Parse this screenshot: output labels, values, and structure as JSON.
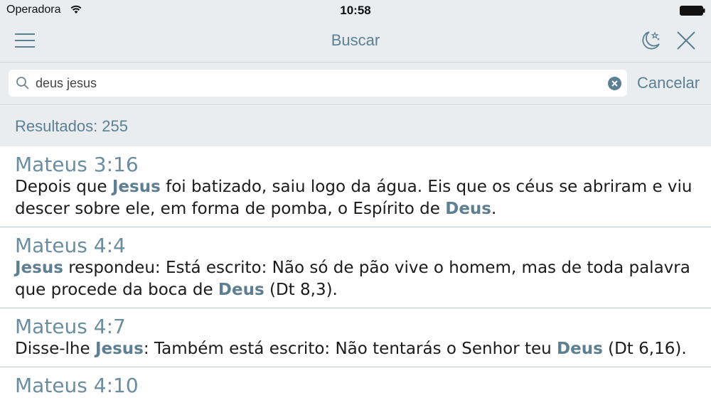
{
  "status": {
    "carrier": "Operadora",
    "time": "10:58"
  },
  "nav": {
    "title": "Buscar",
    "menu_icon": "hamburger-icon",
    "night_icon": "night-mode-icon",
    "close_icon": "close-icon"
  },
  "search": {
    "value": "deus jesus",
    "placeholder": "",
    "cancel_label": "Cancelar"
  },
  "results": {
    "count_label": "Resultados: 255",
    "items": [
      {
        "ref": "Mateus 3:16",
        "segments": [
          {
            "t": "Depois que ",
            "b": false
          },
          {
            "t": "Jesus",
            "b": true
          },
          {
            "t": " foi batizado, saiu logo da água. Eis que os céus se abriram e viu descer sobre ele, em forma de pomba, o Espírito de ",
            "b": false
          },
          {
            "t": "Deus",
            "b": true
          },
          {
            "t": ".",
            "b": false
          }
        ]
      },
      {
        "ref": "Mateus 4:4",
        "segments": [
          {
            "t": "Jesus",
            "b": true
          },
          {
            "t": " respondeu: Está escrito: Não só de pão vive o homem, mas de toda palavra que procede da boca de ",
            "b": false
          },
          {
            "t": "Deus",
            "b": true
          },
          {
            "t": " (Dt 8,3).",
            "b": false
          }
        ]
      },
      {
        "ref": "Mateus 4:7",
        "segments": [
          {
            "t": "Disse-lhe ",
            "b": false
          },
          {
            "t": "Jesus",
            "b": true
          },
          {
            "t": ": Também está escrito: Não tentarás o Senhor teu ",
            "b": false
          },
          {
            "t": "Deus",
            "b": true
          },
          {
            "t": " (Dt 6,16).",
            "b": false
          }
        ]
      },
      {
        "ref": "Mateus 4:10",
        "segments": []
      }
    ]
  },
  "colors": {
    "accent": "#5b7f93",
    "bar_bg": "#e9edf0",
    "highlight": "#5d7f91",
    "divider": "#b9c5cc"
  }
}
